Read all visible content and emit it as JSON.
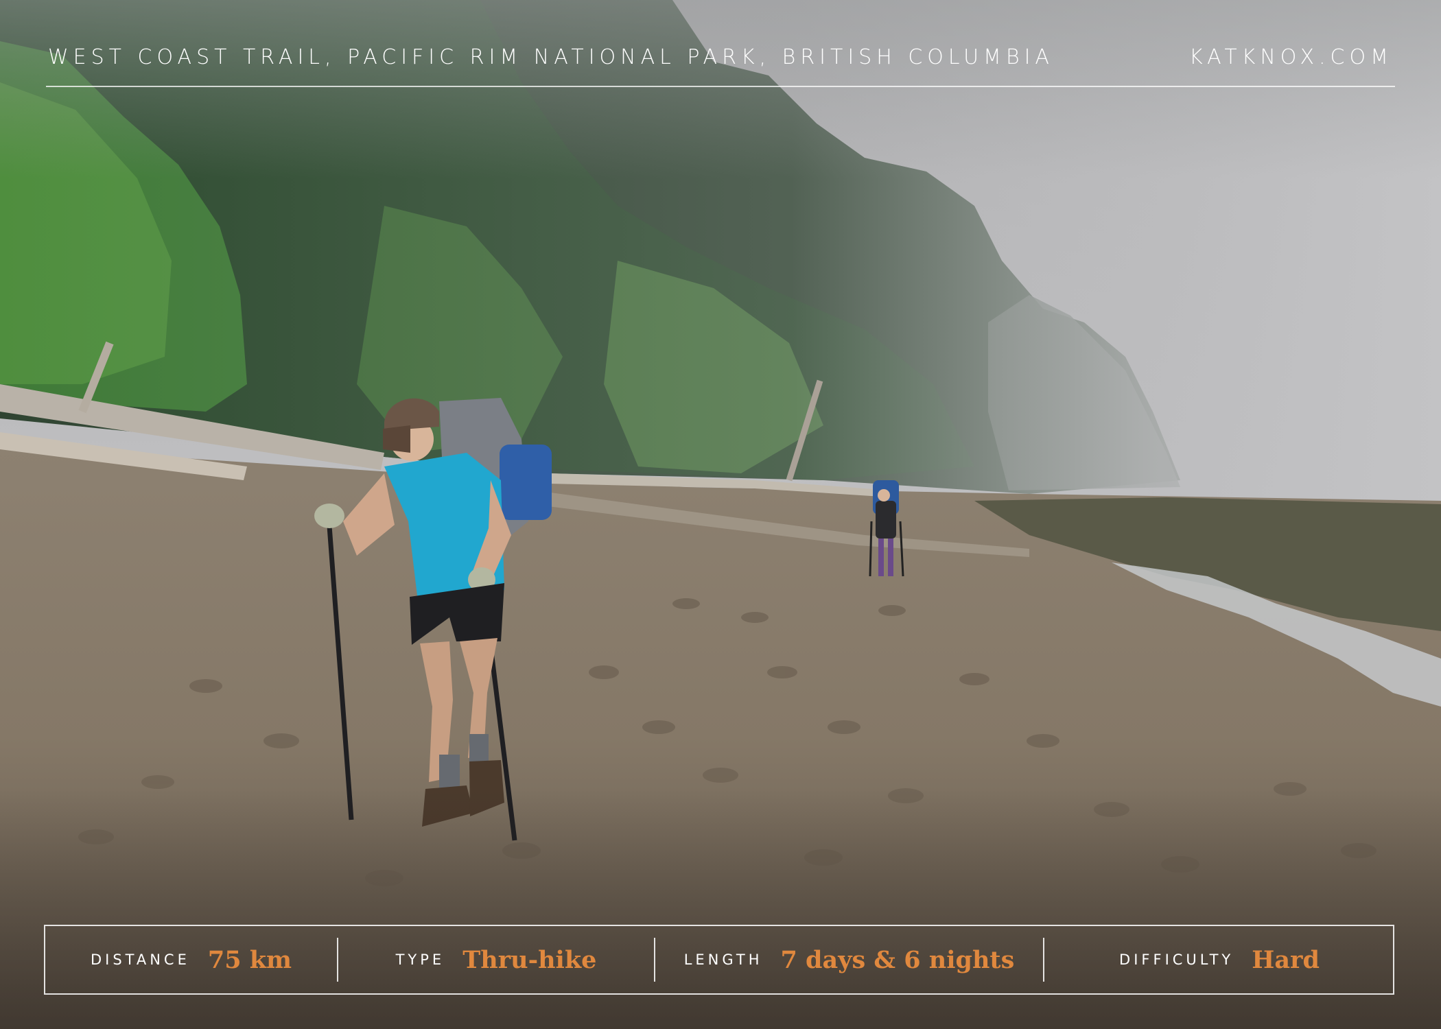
{
  "header": {
    "location": "WEST COAST TRAIL, PACIFIC RIM NATIONAL PARK, BRITISH COLUMBIA",
    "website": "KATKNOX.COM"
  },
  "stats": [
    {
      "label": "DISTANCE",
      "value": "75 km"
    },
    {
      "label": "TYPE",
      "value": "Thru-hike"
    },
    {
      "label": "LENGTH",
      "value": "7 days & 6 nights"
    },
    {
      "label": "DIFFICULTY",
      "value": "Hard"
    }
  ],
  "colors": {
    "accent": "#e0883e",
    "text": "#ffffff"
  }
}
